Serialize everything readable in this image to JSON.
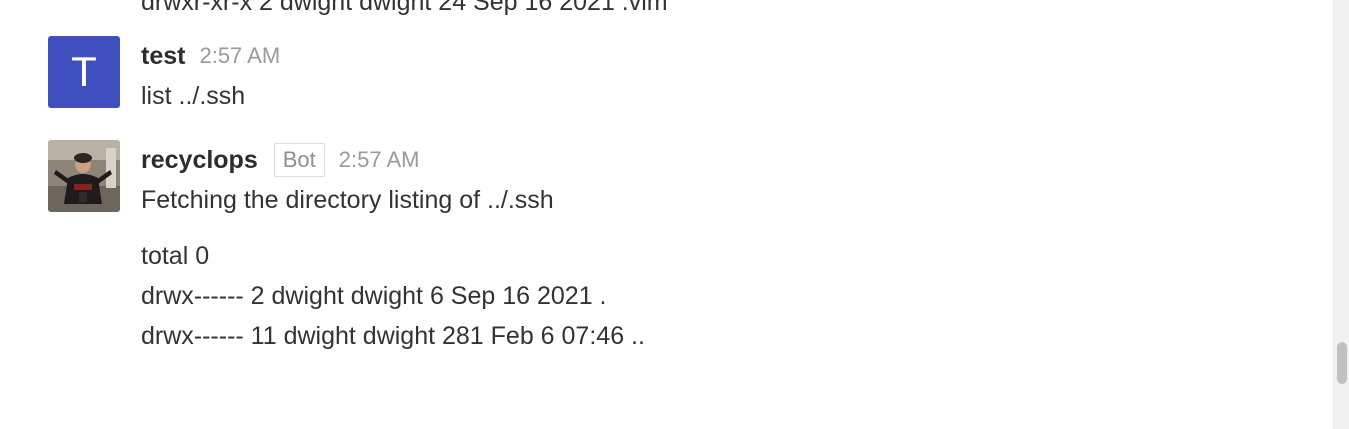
{
  "partial_previous_line": "drwxr-xr-x 2 dwight dwight 24 Sep 16 2021 .vim",
  "messages": [
    {
      "avatar_letter": "T",
      "avatar_color": "#3f4fbd",
      "username": "test",
      "time": "2:57 AM",
      "lines": [
        "list ../.ssh"
      ]
    },
    {
      "avatar_icon": "user-photo",
      "username": "recyclops",
      "badge": "Bot",
      "time": "2:57 AM",
      "lines": [
        "Fetching the directory listing of ../.ssh"
      ],
      "listing": [
        "total 0",
        "drwx------ 2 dwight dwight 6 Sep 16 2021 .",
        "drwx------ 11 dwight dwight 281 Feb 6 07:46 .."
      ]
    }
  ]
}
